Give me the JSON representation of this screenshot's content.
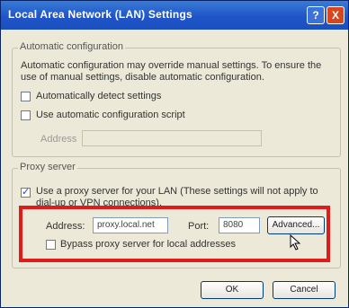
{
  "window": {
    "title": "Local Area Network (LAN) Settings",
    "help_glyph": "?",
    "close_glyph": "X"
  },
  "automatic": {
    "legend": "Automatic configuration",
    "description": "Automatic configuration may override manual settings. To ensure the use of manual settings, disable automatic configuration.",
    "detect_label": "Automatically detect settings",
    "detect_checked": false,
    "script_label": "Use automatic configuration script",
    "script_checked": false,
    "address_placeholder": "Address"
  },
  "proxy": {
    "legend": "Proxy server",
    "use_proxy_label": "Use a proxy server for your LAN (These settings will not apply to dial-up or VPN connections).",
    "use_proxy_checked": true,
    "address_label": "Address:",
    "address_value": "proxy.local.net",
    "port_label": "Port:",
    "port_value": "8080",
    "advanced_label": "Advanced...",
    "bypass_label": "Bypass proxy server for local addresses",
    "bypass_checked": false
  },
  "buttons": {
    "ok": "OK",
    "cancel": "Cancel"
  },
  "colors": {
    "highlight": "#e01b1b",
    "titlebar": "#1f55c8"
  }
}
